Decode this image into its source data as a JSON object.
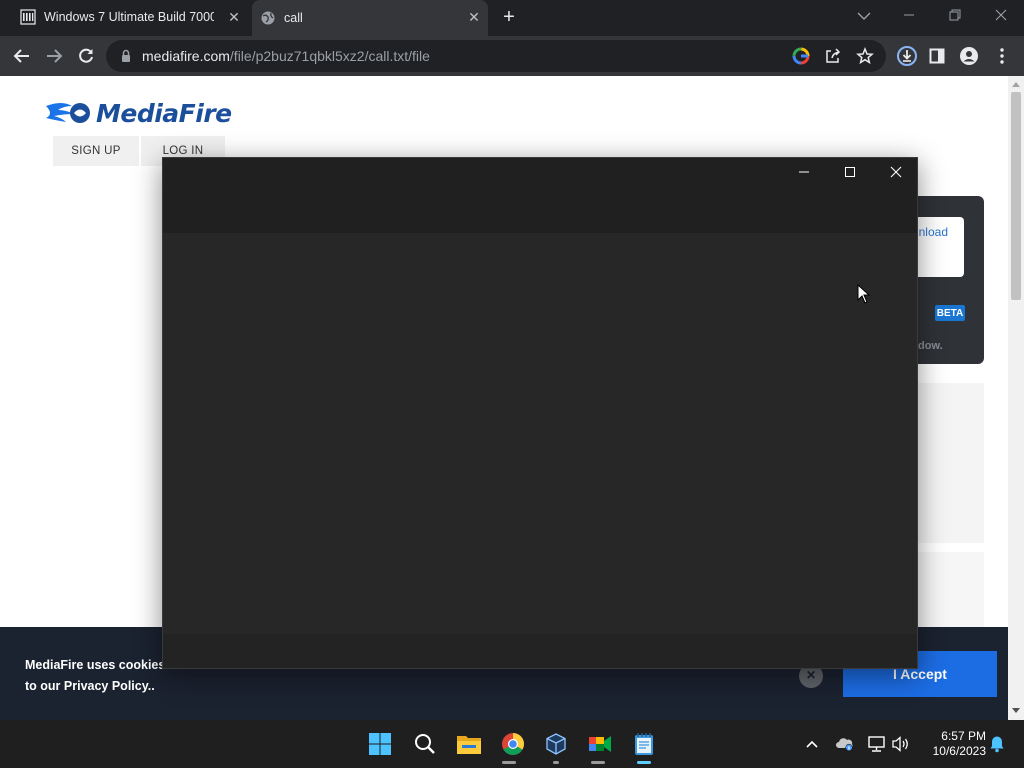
{
  "browser": {
    "tabs": [
      {
        "title": "Windows 7 Ultimate Build 7000 :",
        "active": false,
        "favicon": "archive-icon"
      },
      {
        "title": "call",
        "active": true,
        "favicon": "globe-icon"
      }
    ],
    "address_bar": {
      "host": "mediafire.com",
      "path": "/file/p2buz71qbkl5xz2/call.txt/file"
    }
  },
  "page": {
    "logo_text": "MediaFire",
    "nav": {
      "sign_up": "SIGN UP",
      "log_in": "LOG IN"
    },
    "download_panel": {
      "button_label_partial": "nload",
      "badge": "BETA",
      "text_partial": "dow."
    },
    "cookie_banner": {
      "line1": "MediaFire uses cookies",
      "line2_prefix": "to our ",
      "link": "Privacy Policy",
      "line2_suffix": "..",
      "accept_label": "I Accept",
      "close_symbol": "×"
    }
  },
  "app_window": {
    "title": "",
    "theme": "dark"
  },
  "taskbar": {
    "apps": [
      "windows-start-icon",
      "search-icon",
      "file-explorer-icon",
      "chrome-icon",
      "virtualbox-icon",
      "google-meet-icon",
      "notepad-icon"
    ],
    "clock": {
      "time": "6:57 PM",
      "date": "10/6/2023"
    }
  },
  "colors": {
    "brand_blue": "#1b4f9c",
    "accept_blue": "#1c6ce3",
    "beta_blue": "#1976d2",
    "taskbar": "#1f1f1f",
    "chrome_dark": "#202124"
  }
}
